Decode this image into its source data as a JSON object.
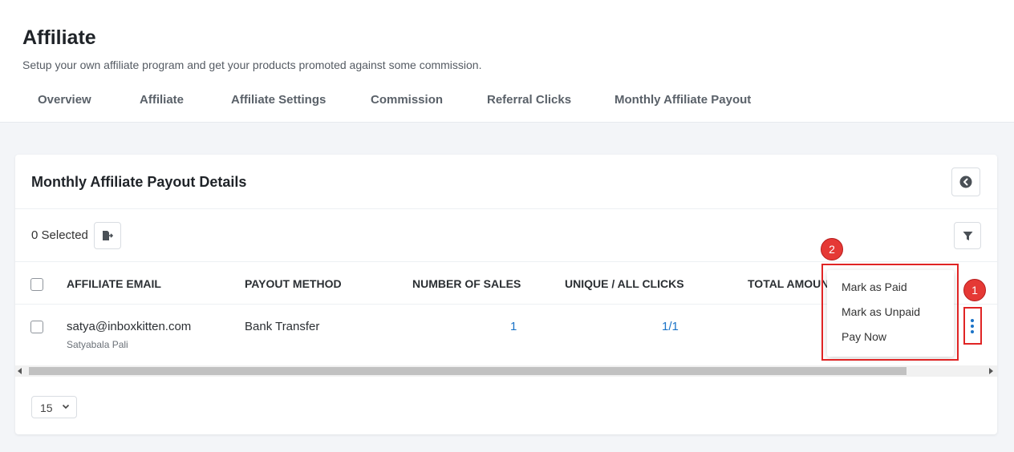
{
  "page": {
    "title": "Affiliate",
    "subtitle": "Setup your own affiliate program and get your products promoted against some commission."
  },
  "tabs": [
    {
      "label": "Overview"
    },
    {
      "label": "Affiliate"
    },
    {
      "label": "Affiliate Settings"
    },
    {
      "label": "Commission"
    },
    {
      "label": "Referral Clicks"
    },
    {
      "label": "Monthly Affiliate Payout"
    }
  ],
  "card": {
    "title": "Monthly Affiliate Payout Details",
    "selected_text": "0 Selected"
  },
  "table": {
    "columns": [
      "AFFILIATE EMAIL",
      "PAYOUT METHOD",
      "NUMBER OF SALES",
      "UNIQUE / ALL CLICKS",
      "TOTAL AMOUN"
    ],
    "rows": [
      {
        "email": "satya@inboxkitten.com",
        "name": "Satyabala Pali",
        "payout_method": "Bank Transfer",
        "sales": "1",
        "clicks": "1/1"
      }
    ]
  },
  "row_menu": {
    "items": [
      "Mark as Paid",
      "Mark as Unpaid",
      "Pay Now"
    ]
  },
  "pagination": {
    "page_size": "15"
  },
  "annotations": {
    "badge_1": "1",
    "badge_2": "2"
  },
  "colors": {
    "accent": "#1a73c7",
    "annotation_red": "#e02424"
  },
  "icons": {
    "back": "circle-chevron-left-icon",
    "export": "file-export-icon",
    "filter": "filter-icon",
    "row_actions": "vertical-ellipsis-icon",
    "select": "chevron-down-icon"
  }
}
